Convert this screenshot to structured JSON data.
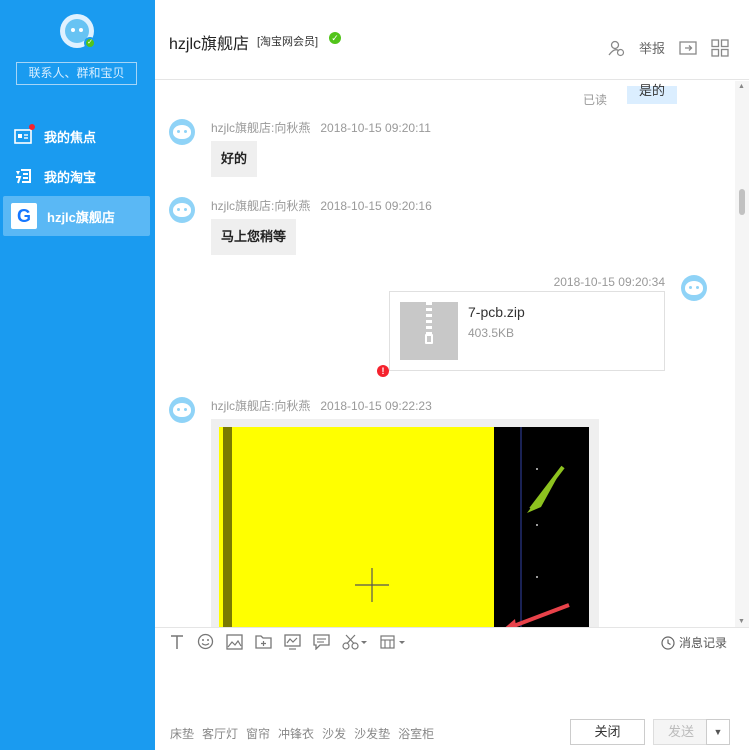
{
  "sidebar": {
    "search_placeholder": "联系人、群和宝贝",
    "items": [
      {
        "label": "我的焦点",
        "icon": "focus-icon"
      },
      {
        "label": "我的淘宝",
        "icon": "taobao-icon"
      },
      {
        "label": "hzjlc旗舰店",
        "icon": "store-logo",
        "logo_letter": "G"
      }
    ]
  },
  "header": {
    "title": "hzjlc旗舰店",
    "badge": "[淘宝网会员]",
    "report_label": "举报"
  },
  "chat": {
    "read_label": "已读",
    "top_bubble_text": "是的",
    "messages": [
      {
        "sender": "hzjlc旗舰店:向秋燕",
        "time": "2018-10-15 09:20:11",
        "text": "好的"
      },
      {
        "sender": "hzjlc旗舰店:向秋燕",
        "time": "2018-10-15 09:20:16",
        "text": "马上您稍等"
      },
      {
        "time": "2018-10-15 09:20:34",
        "file_name": "7-pcb.zip",
        "file_size": "403.5KB"
      },
      {
        "sender": "hzjlc旗舰店:向秋燕",
        "time": "2018-10-15 09:22:23"
      }
    ],
    "error_mark": "!"
  },
  "toolbar": {
    "history_label": "消息记录"
  },
  "footer": {
    "quick_phrases": [
      "床垫",
      "客厅灯",
      "窗帘",
      "冲锋衣",
      "沙发",
      "沙发垫",
      "浴室柜"
    ],
    "close_label": "关闭",
    "send_label": "发送",
    "dropdown_label": "▼"
  },
  "colors": {
    "sidebar_bg": "#1a9bf0",
    "active_item_bg": "#5ab8f5",
    "bubble_bg": "#efefef",
    "verified": "#52c41a",
    "error": "#f5222d",
    "pcb_yellow": "#ffff00",
    "arrow_green": "#8dc21f",
    "arrow_red": "#e8424a"
  }
}
